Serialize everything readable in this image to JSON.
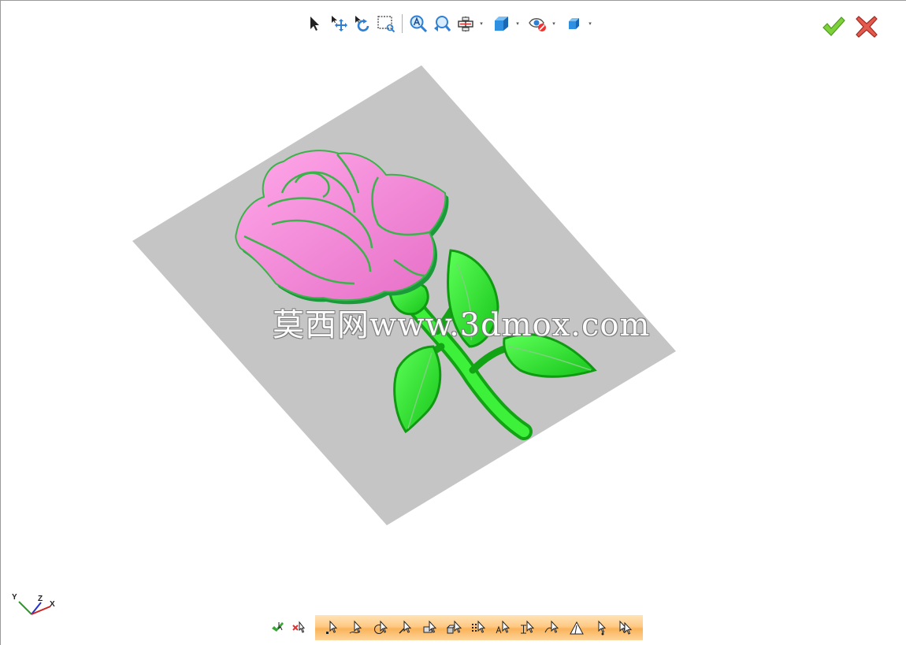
{
  "watermark": "莫西网www.3dmox.com",
  "axes": {
    "y": "Y",
    "z": "Z",
    "x": "X"
  },
  "colors": {
    "plane": "#c5c5c5",
    "petal": "#f48ad6",
    "petal_dark": "#d85fba",
    "petal_edge": "#3bb34a",
    "leaf": "#2ee82a",
    "leaf_dark": "#17a91a",
    "toolbar_bar": "#ffc984"
  },
  "toolbar": {
    "icons": [
      "select-arrow-icon",
      "pan-icon",
      "rotate-icon",
      "zoom-box-icon",
      "zoom-all-icon",
      "zoom-previous-icon",
      "section-view-icon",
      "view-cube-icon",
      "hide-show-icon",
      "display-mode-icon"
    ]
  },
  "actions": {
    "accept": "accept-icon",
    "cancel": "cancel-icon"
  },
  "selection_filters": [
    "filter-point-icon",
    "filter-curve-icon",
    "filter-circle-icon",
    "filter-edge-icon",
    "filter-face-icon",
    "filter-body-icon",
    "filter-grid-icon",
    "filter-text-icon",
    "filter-dimension-icon",
    "filter-surface-icon",
    "filter-triangle-icon",
    "filter-vertex-icon",
    "filter-all-icon"
  ]
}
